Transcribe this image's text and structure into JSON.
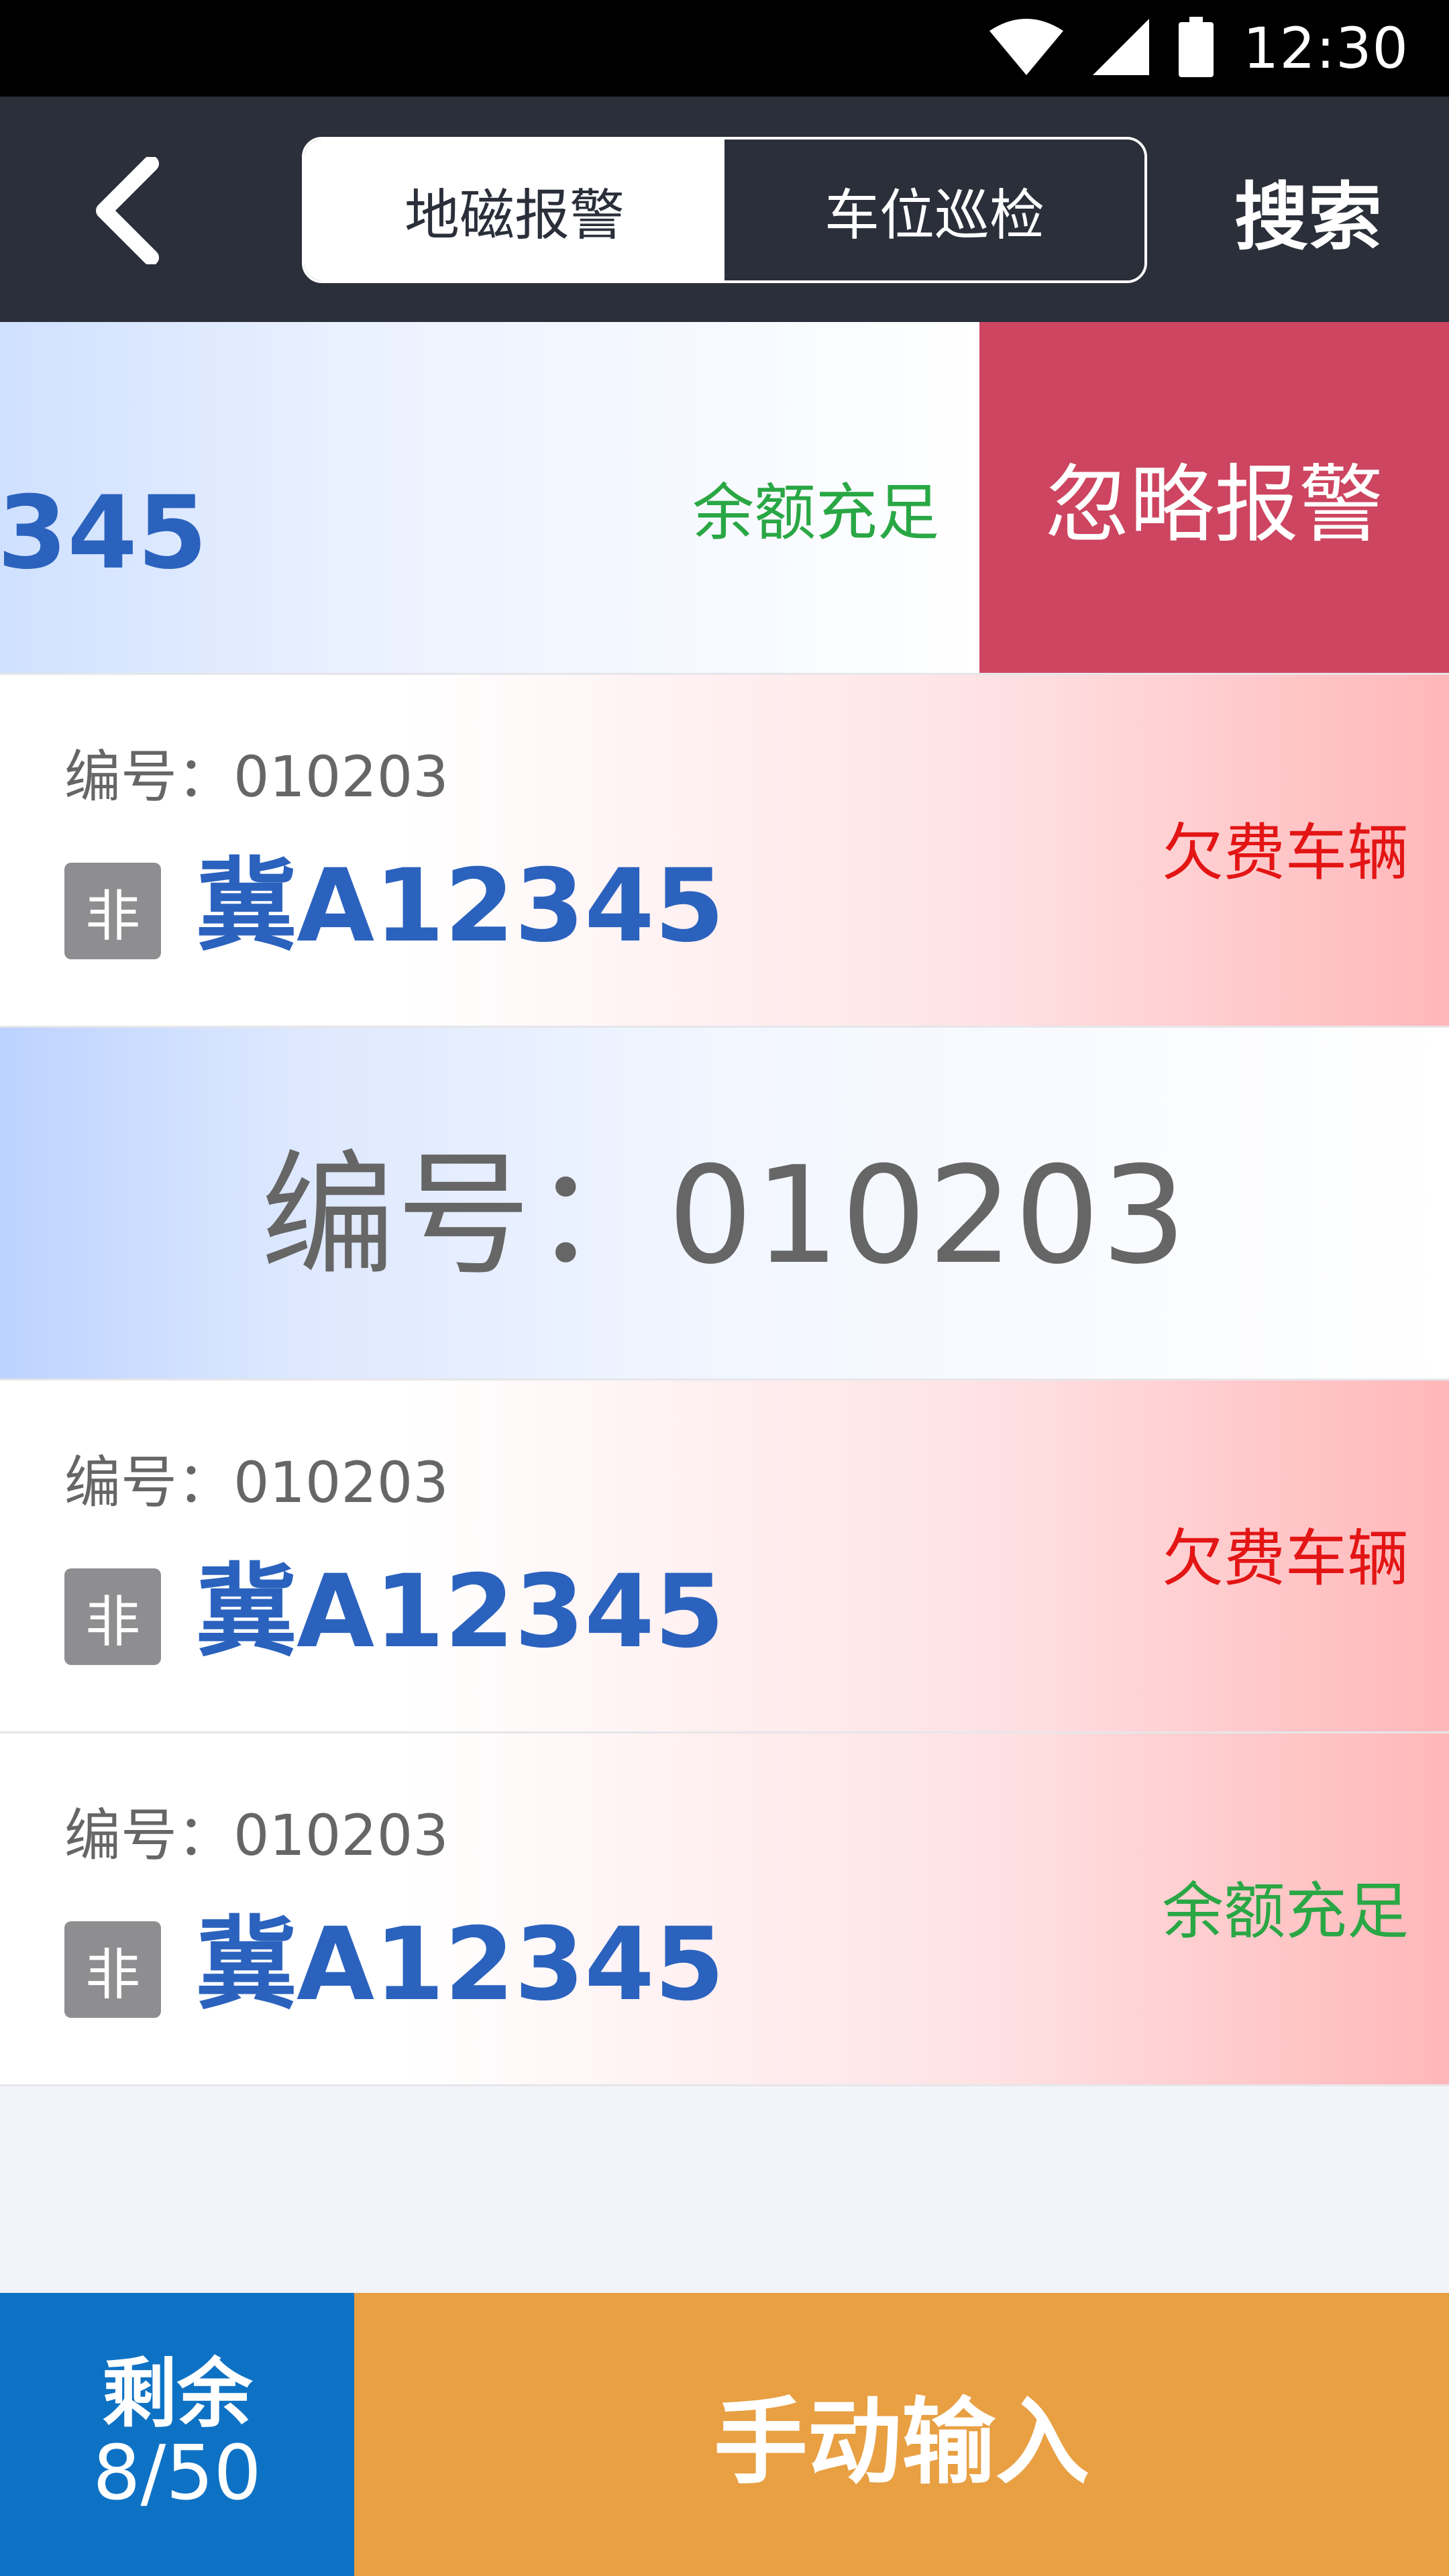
{
  "status_bar": {
    "time": "12:30",
    "icons": [
      "wifi-icon",
      "cell-signal-icon",
      "battery-icon"
    ]
  },
  "nav": {
    "back_icon": "chevron-left-icon",
    "tabs": [
      {
        "label": "地磁报警",
        "active": true
      },
      {
        "label": "车位巡检",
        "active": false
      }
    ],
    "search_label": "搜索"
  },
  "list": {
    "swiped_row": {
      "plate_partial": "345",
      "status": "余额充足",
      "action_label": "忽略报警"
    },
    "rows": [
      {
        "code": "编号：010203",
        "badge": "非",
        "plate": "冀A12345",
        "status": "欠费车辆"
      },
      {
        "code": "编号：010203",
        "badge": "非",
        "plate": "冀A12345",
        "status": "欠费车辆"
      },
      {
        "code": "编号：010203",
        "badge": "非",
        "plate": "冀A12345",
        "status": "余额充足"
      }
    ],
    "highlight_code": "编号：010203"
  },
  "bottom": {
    "remain_label": "剩余",
    "remain_count": "8/50",
    "manual_input_label": "手动输入"
  },
  "colors": {
    "nav_bg": "#2b2f3a",
    "plate_blue": "#2b62be",
    "arrears_red": "#e31515",
    "ok_green": "#2aa745",
    "ignore_red": "#cd4560",
    "remain_blue": "#0e72c4",
    "manual_orange": "#e8a043"
  }
}
